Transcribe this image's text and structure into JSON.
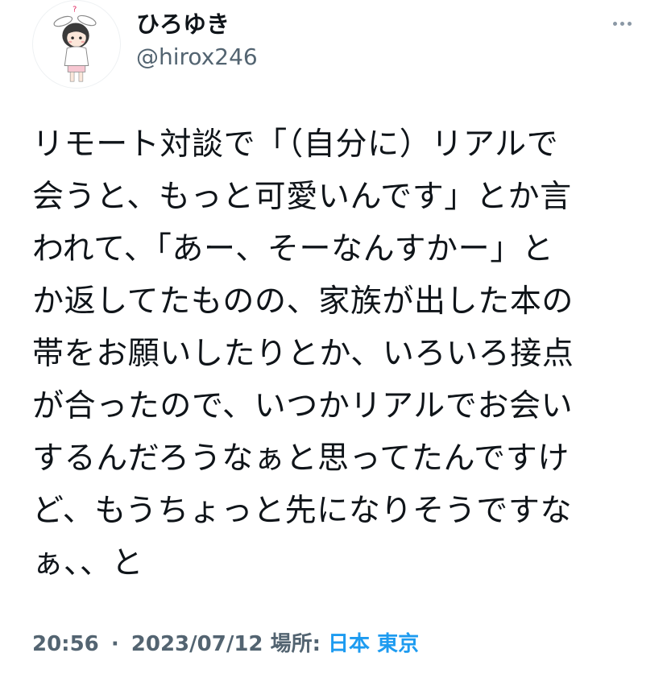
{
  "author": {
    "display_name": "ひろゆき",
    "handle": "@hirox246",
    "avatar_icon": "user-avatar-rabbit-ears-icon"
  },
  "more_icon": "more-horizontal-icon",
  "tweet": {
    "lines": [
      "リモート対談で「（自分に）リアルで",
      "会うと、もっと可愛いんです」とか言",
      "われて、「あー、そーなんすかー」と",
      "か返してたものの、家族が出した本の",
      "帯をお願いしたりとか、いろいろ接点",
      "が合ったので、いつかリアルでお会い",
      "するんだろうなぁと思ってたんですけ",
      "ど、もうちょっと先になりそうですな",
      "ぁ、、と"
    ]
  },
  "meta": {
    "time": "20:56",
    "separator": "·",
    "date": "2023/07/12",
    "location_label": "場所:",
    "location": "日本 東京"
  },
  "colors": {
    "text": "#0f1419",
    "secondary": "#536471",
    "link": "#1d9bf0"
  }
}
